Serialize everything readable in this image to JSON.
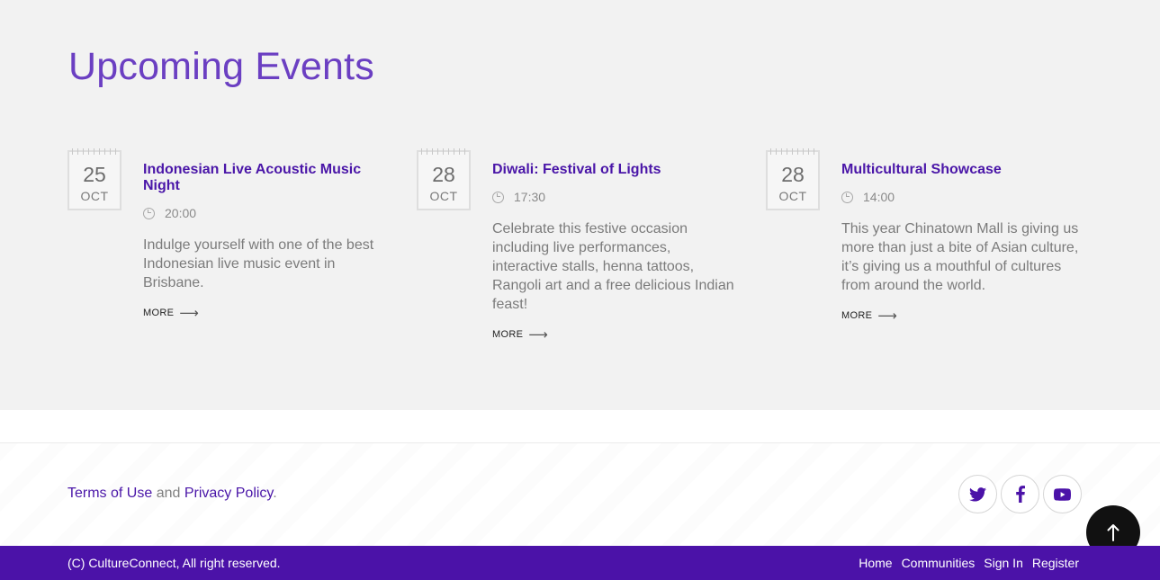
{
  "section": {
    "title": "Upcoming Events"
  },
  "events": [
    {
      "day": "25",
      "month": "OCT",
      "title": "Indonesian Live Acoustic Music Night",
      "time": "20:00",
      "description": "Indulge yourself with one of the best Indonesian live music event in Brisbane.",
      "more_label": "MORE"
    },
    {
      "day": "28",
      "month": "OCT",
      "title": "Diwali: Festival of Lights",
      "time": "17:30",
      "description": "Celebrate this festive occasion including live performances, interactive stalls, henna tattoos, Rangoli art and a free delicious Indian feast!",
      "more_label": "MORE"
    },
    {
      "day": "28",
      "month": "OCT",
      "title": "Multicultural Showcase",
      "time": "14:00",
      "description": "This year Chinatown Mall is giving us more than just a bite of Asian culture, it’s giving us a mouthful of cultures from around the world.",
      "more_label": "MORE"
    }
  ],
  "footer": {
    "terms_label": "Terms of Use",
    "and_text": " and ",
    "privacy_label": "Privacy Policy",
    "period": ".",
    "social": [
      {
        "icon": "twitter-icon"
      },
      {
        "icon": "facebook-icon"
      },
      {
        "icon": "youtube-icon"
      }
    ],
    "scroll_top_icon": "arrow-up-icon",
    "copyright": "(C) CultureConnect, All right reserved.",
    "nav": [
      "Home",
      "Communities",
      "Sign In",
      "Register"
    ]
  },
  "colors": {
    "brand": "#4b12a8",
    "title_purple": "#6b3fc2",
    "event_title": "#4a16a8",
    "section_bg": "#f2f2f2"
  }
}
